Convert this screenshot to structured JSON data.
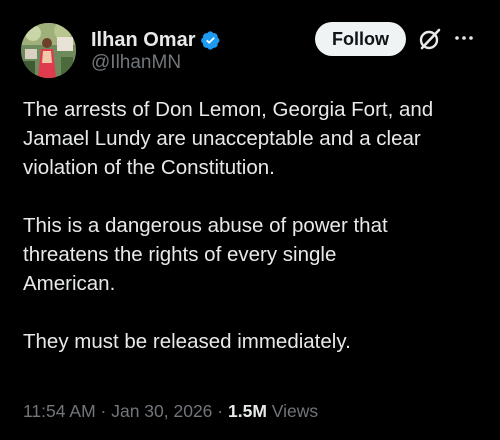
{
  "author": {
    "display_name": "Ilhan Omar",
    "handle": "@IlhanMN",
    "verified": true
  },
  "actions": {
    "follow_label": "Follow",
    "grok_icon": "grok-slash-icon",
    "more_icon": "more-dots-icon"
  },
  "tweet": {
    "paragraphs": [
      {
        "lines": [
          "The arrests of Don Lemon, Georgia Fort, and",
          "Jamael Lundy are unacceptable and a clear",
          "violation of the Constitution."
        ]
      },
      {
        "lines": [
          "This is a dangerous abuse of power that",
          "threatens the rights of every single",
          "American."
        ]
      },
      {
        "lines": [
          "They must be released immediately."
        ]
      }
    ]
  },
  "meta": {
    "time": "11:54 AM",
    "separator": "·",
    "date": "Jan 30, 2026",
    "views_count": "1.5M",
    "views_label": "Views"
  },
  "colors": {
    "background": "#000000",
    "text_primary": "#e7e9ea",
    "text_secondary": "#71767b",
    "verified_badge": "#1d9bf0",
    "follow_bg": "#eff3f4"
  }
}
